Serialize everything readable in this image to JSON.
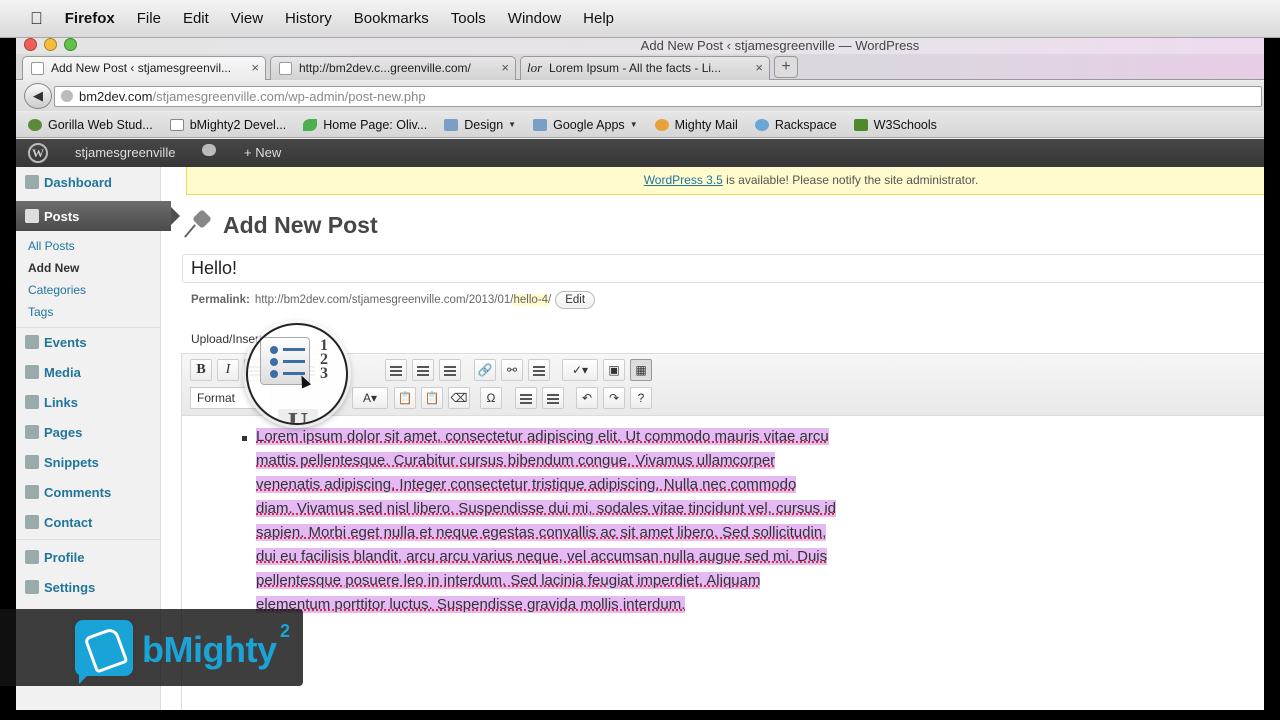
{
  "menubar": {
    "items": [
      "Firefox",
      "File",
      "Edit",
      "View",
      "History",
      "Bookmarks",
      "Tools",
      "Window",
      "Help"
    ]
  },
  "window": {
    "title": "Add New Post ‹ stjamesgreenville — WordPress"
  },
  "tabs": [
    {
      "label": "Add New Post ‹ stjamesgreenvil...",
      "active": true
    },
    {
      "label": "http://bm2dev.c...greenville.com/",
      "active": false
    },
    {
      "label": "Lorem Ipsum - All the facts - Li...",
      "active": false,
      "favicon": "lor"
    }
  ],
  "urlbar": {
    "host": "bm2dev.com",
    "path": "/stjamesgreenville.com/wp-admin/post-new.php"
  },
  "bookmarks": [
    {
      "label": "Gorilla Web Stud...",
      "icon": "gorilla-icon"
    },
    {
      "label": "bMighty2 Devel...",
      "icon": "page-icon"
    },
    {
      "label": "Home Page: Oliv...",
      "icon": "leaf-icon"
    },
    {
      "label": "Design",
      "icon": "folder-icon",
      "folder": true
    },
    {
      "label": "Google Apps",
      "icon": "folder-icon",
      "folder": true
    },
    {
      "label": "Mighty Mail",
      "icon": "mail-icon"
    },
    {
      "label": "Rackspace",
      "icon": "cloud-icon"
    },
    {
      "label": "W3Schools",
      "icon": "w3-icon"
    }
  ],
  "adminbar": {
    "site": "stjamesgreenville",
    "new_label": "New"
  },
  "sidebar": {
    "dashboard": "Dashboard",
    "posts": "Posts",
    "posts_sub": [
      "All Posts",
      "Add New",
      "Categories",
      "Tags"
    ],
    "items": [
      "Events",
      "Media",
      "Links",
      "Pages",
      "Snippets",
      "Comments",
      "Contact"
    ],
    "items2": [
      "Profile",
      "Settings"
    ]
  },
  "notice": {
    "link": "WordPress 3.5",
    "text": " is available! Please notify the site administrator."
  },
  "page": {
    "title": "Add New Post"
  },
  "post": {
    "title": "Hello!",
    "permalink_label": "Permalink:",
    "permalink_base": "http://bm2dev.com/stjamesgreenville.com/2013/01/",
    "permalink_slug": "hello-4",
    "permalink_end": "/",
    "edit_label": "Edit",
    "upload_label": "Upload/Insert"
  },
  "editor": {
    "bold": "B",
    "italic": "I",
    "format_label": "Format",
    "body": "Lorem ipsum dolor sit amet, consectetur adipiscing elit. Ut commodo mauris vitae arcu mattis pellentesque. Curabitur cursus bibendum congue. Vivamus ullamcorper venenatis adipiscing. Integer consectetur tristique adipiscing. Nulla nec commodo diam. Vivamus sed nisl libero. Suspendisse dui mi, sodales vitae tincidunt vel, cursus id sapien. Morbi eget nulla et neque egestas convallis ac sit amet libero. Sed sollicitudin, dui eu facilisis blandit, arcu arcu varius neque, vel accumsan nulla augue sed mi. Duis pellentesque posuere leo in interdum. Sed lacinia feugiat imperdiet. Aliquam elementum porttitor luctus. Suspendisse gravida mollis interdum."
  },
  "brand": {
    "name": "bMighty",
    "sup": "2",
    "color": "#1aa3d6"
  }
}
